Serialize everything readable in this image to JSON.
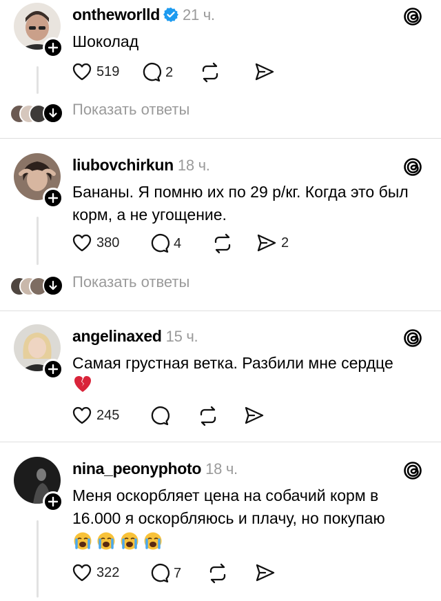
{
  "posts": [
    {
      "username": "ontheworlld",
      "verified": true,
      "time": "21 ч.",
      "text": "Шоколад",
      "likes": "519",
      "comments": "2",
      "shares": "",
      "show_replies": "Показать ответы"
    },
    {
      "username": "liubovchirkun",
      "verified": false,
      "time": "18 ч.",
      "text": "Бананы. Я помню их по 29 р/кг. Когда это был корм, а не угощение.",
      "likes": "380",
      "comments": "4",
      "shares": "2",
      "show_replies": "Показать ответы"
    },
    {
      "username": "angelinaxed",
      "verified": false,
      "time": "15 ч.",
      "text": "Самая грустная ветка. Разбили мне сердце",
      "emoji": "broken-heart",
      "likes": "245",
      "comments": "",
      "shares": ""
    },
    {
      "username": "nina_peonyphoto",
      "verified": false,
      "time": "18 ч.",
      "text": "Меня оскорбляет цена на собачий корм в 16.000 я оскорбляюсь и плачу, но покупаю",
      "emoji": "loudly-crying-face x4",
      "likes": "322",
      "comments": "7",
      "shares": ""
    }
  ],
  "icons": {
    "like": "heart-outline-icon",
    "comment": "speech-bubble-icon",
    "repost": "repost-arrows-icon",
    "share": "paper-plane-icon",
    "threads": "threads-logo-icon",
    "verified": "verified-badge-icon"
  },
  "colors": {
    "verified": "#1d9bf0",
    "muted": "#9a9a9a",
    "divider": "#dedede"
  }
}
